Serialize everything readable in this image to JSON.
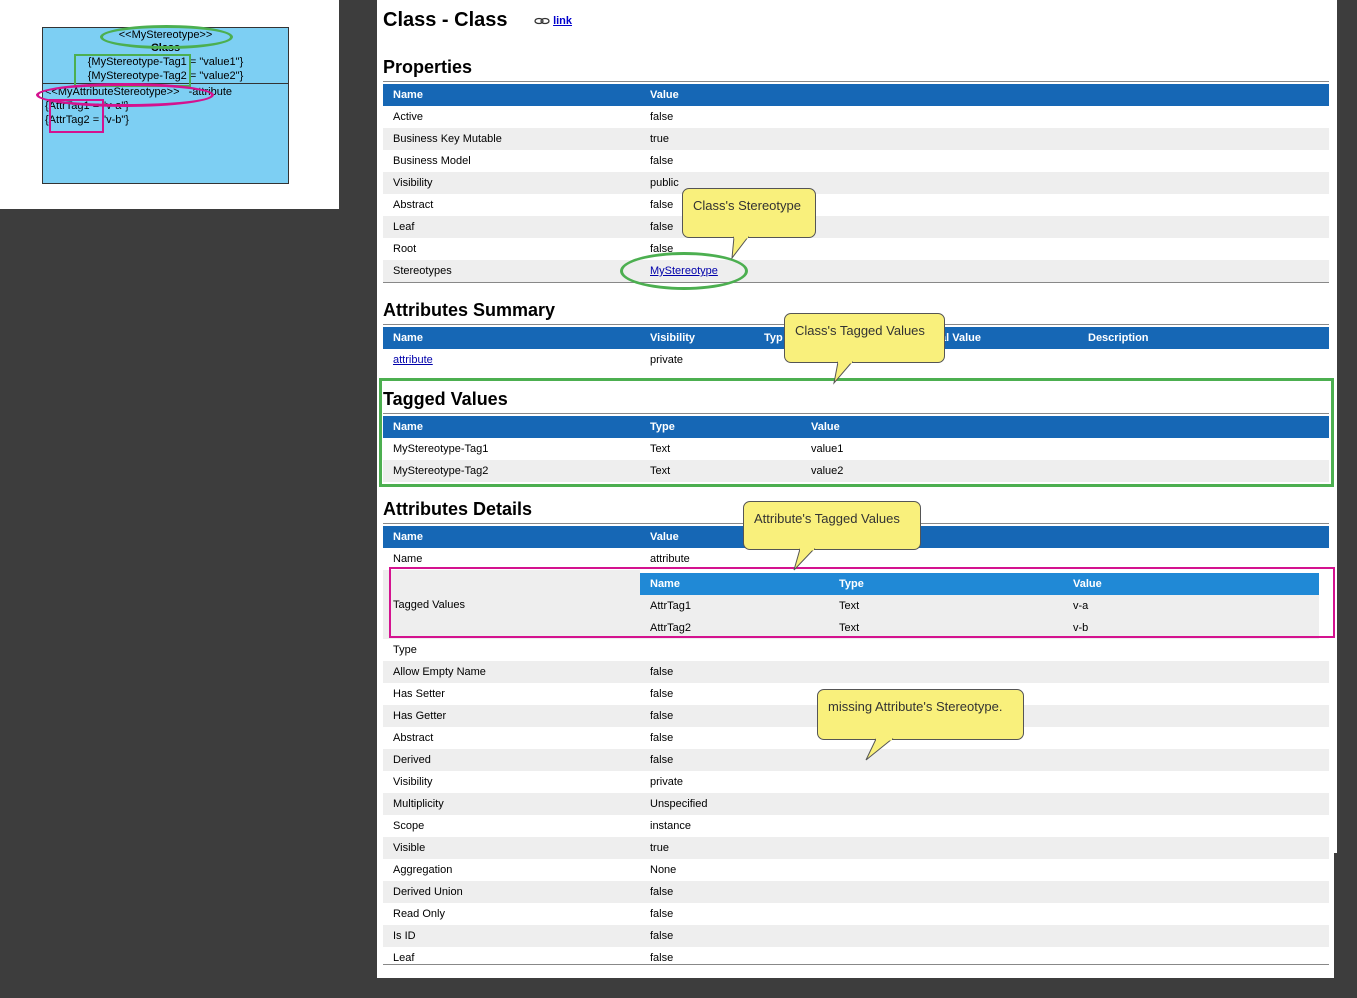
{
  "diagram": {
    "stereotype": "<<MyStereotype>>",
    "class_name": "Class",
    "class_tag1": "{MyStereotype-Tag1 = \"value1\"}",
    "class_tag2": "{MyStereotype-Tag2 = \"value2\"}",
    "attr_stereotype": "<<MyAttributeStereotype>>",
    "attr_name": "-attribute",
    "attr_tag1": "{AttrTag1 = \"v-a\"}",
    "attr_tag2": "{AttrTag2 = \"v-b\"}",
    "colors": {
      "fill": "#7dcff3",
      "green": "#4caf50",
      "magenta": "#d4128f"
    }
  },
  "report": {
    "title": "Class - Class",
    "link_icon": "link-icon",
    "link_label": "link",
    "properties": {
      "heading": "Properties",
      "headers": {
        "name": "Name",
        "value": "Value"
      },
      "rows": [
        {
          "name": "Active",
          "value": "false"
        },
        {
          "name": "Business Key Mutable",
          "value": "true"
        },
        {
          "name": "Business Model",
          "value": "false"
        },
        {
          "name": "Visibility",
          "value": "public"
        },
        {
          "name": "Abstract",
          "value": "false"
        },
        {
          "name": "Leaf",
          "value": "false"
        },
        {
          "name": "Root",
          "value": "false"
        },
        {
          "name": "Stereotypes",
          "value": "MyStereotype"
        }
      ]
    },
    "attributes_summary": {
      "heading": "Attributes Summary",
      "headers": {
        "name": "Name",
        "visibility": "Visibility",
        "type": "Typ",
        "initial": "al Value",
        "description": "Description"
      },
      "rows": [
        {
          "name": "attribute",
          "visibility": "private"
        }
      ]
    },
    "tagged_values": {
      "heading": "Tagged Values",
      "headers": {
        "name": "Name",
        "type": "Type",
        "value": "Value"
      },
      "rows": [
        {
          "name": "MyStereotype-Tag1",
          "type": "Text",
          "value": "value1"
        },
        {
          "name": "MyStereotype-Tag2",
          "type": "Text",
          "value": "value2"
        }
      ]
    },
    "attributes_details": {
      "heading": "Attributes Details",
      "headers": {
        "name": "Name",
        "value": "Value"
      },
      "name_row": {
        "name": "Name",
        "value": "attribute"
      },
      "tagged_label": "Tagged Values",
      "nested_headers": {
        "name": "Name",
        "type": "Type",
        "value": "Value"
      },
      "nested_rows": [
        {
          "name": "AttrTag1",
          "type": "Text",
          "value": "v-a"
        },
        {
          "name": "AttrTag2",
          "type": "Text",
          "value": "v-b"
        }
      ],
      "rows": [
        {
          "name": "Type",
          "value": ""
        },
        {
          "name": "Allow Empty Name",
          "value": "false"
        },
        {
          "name": "Has Setter",
          "value": "false"
        },
        {
          "name": "Has Getter",
          "value": "false"
        },
        {
          "name": "Abstract",
          "value": "false"
        },
        {
          "name": "Derived",
          "value": "false"
        },
        {
          "name": "Visibility",
          "value": "private"
        },
        {
          "name": "Multiplicity",
          "value": "Unspecified"
        },
        {
          "name": "Scope",
          "value": "instance"
        },
        {
          "name": "Visible",
          "value": "true"
        },
        {
          "name": "Aggregation",
          "value": "None"
        },
        {
          "name": "Derived Union",
          "value": "false"
        },
        {
          "name": "Read Only",
          "value": "false"
        },
        {
          "name": "Is ID",
          "value": "false"
        },
        {
          "name": "Leaf",
          "value": "false"
        }
      ]
    }
  },
  "callouts": {
    "class_stereotype": "Class's Stereotype",
    "class_tagged_values": "Class's Tagged Values",
    "attribute_tagged_values": "Attribute's Tagged Values",
    "missing_attr_stereotype": "missing Attribute's Stereotype."
  },
  "colors": {
    "header_blue": "#1667b5",
    "nested_header_blue": "#2089d6",
    "callout_yellow": "#f9f07c",
    "stripe": "#eeeeee"
  }
}
